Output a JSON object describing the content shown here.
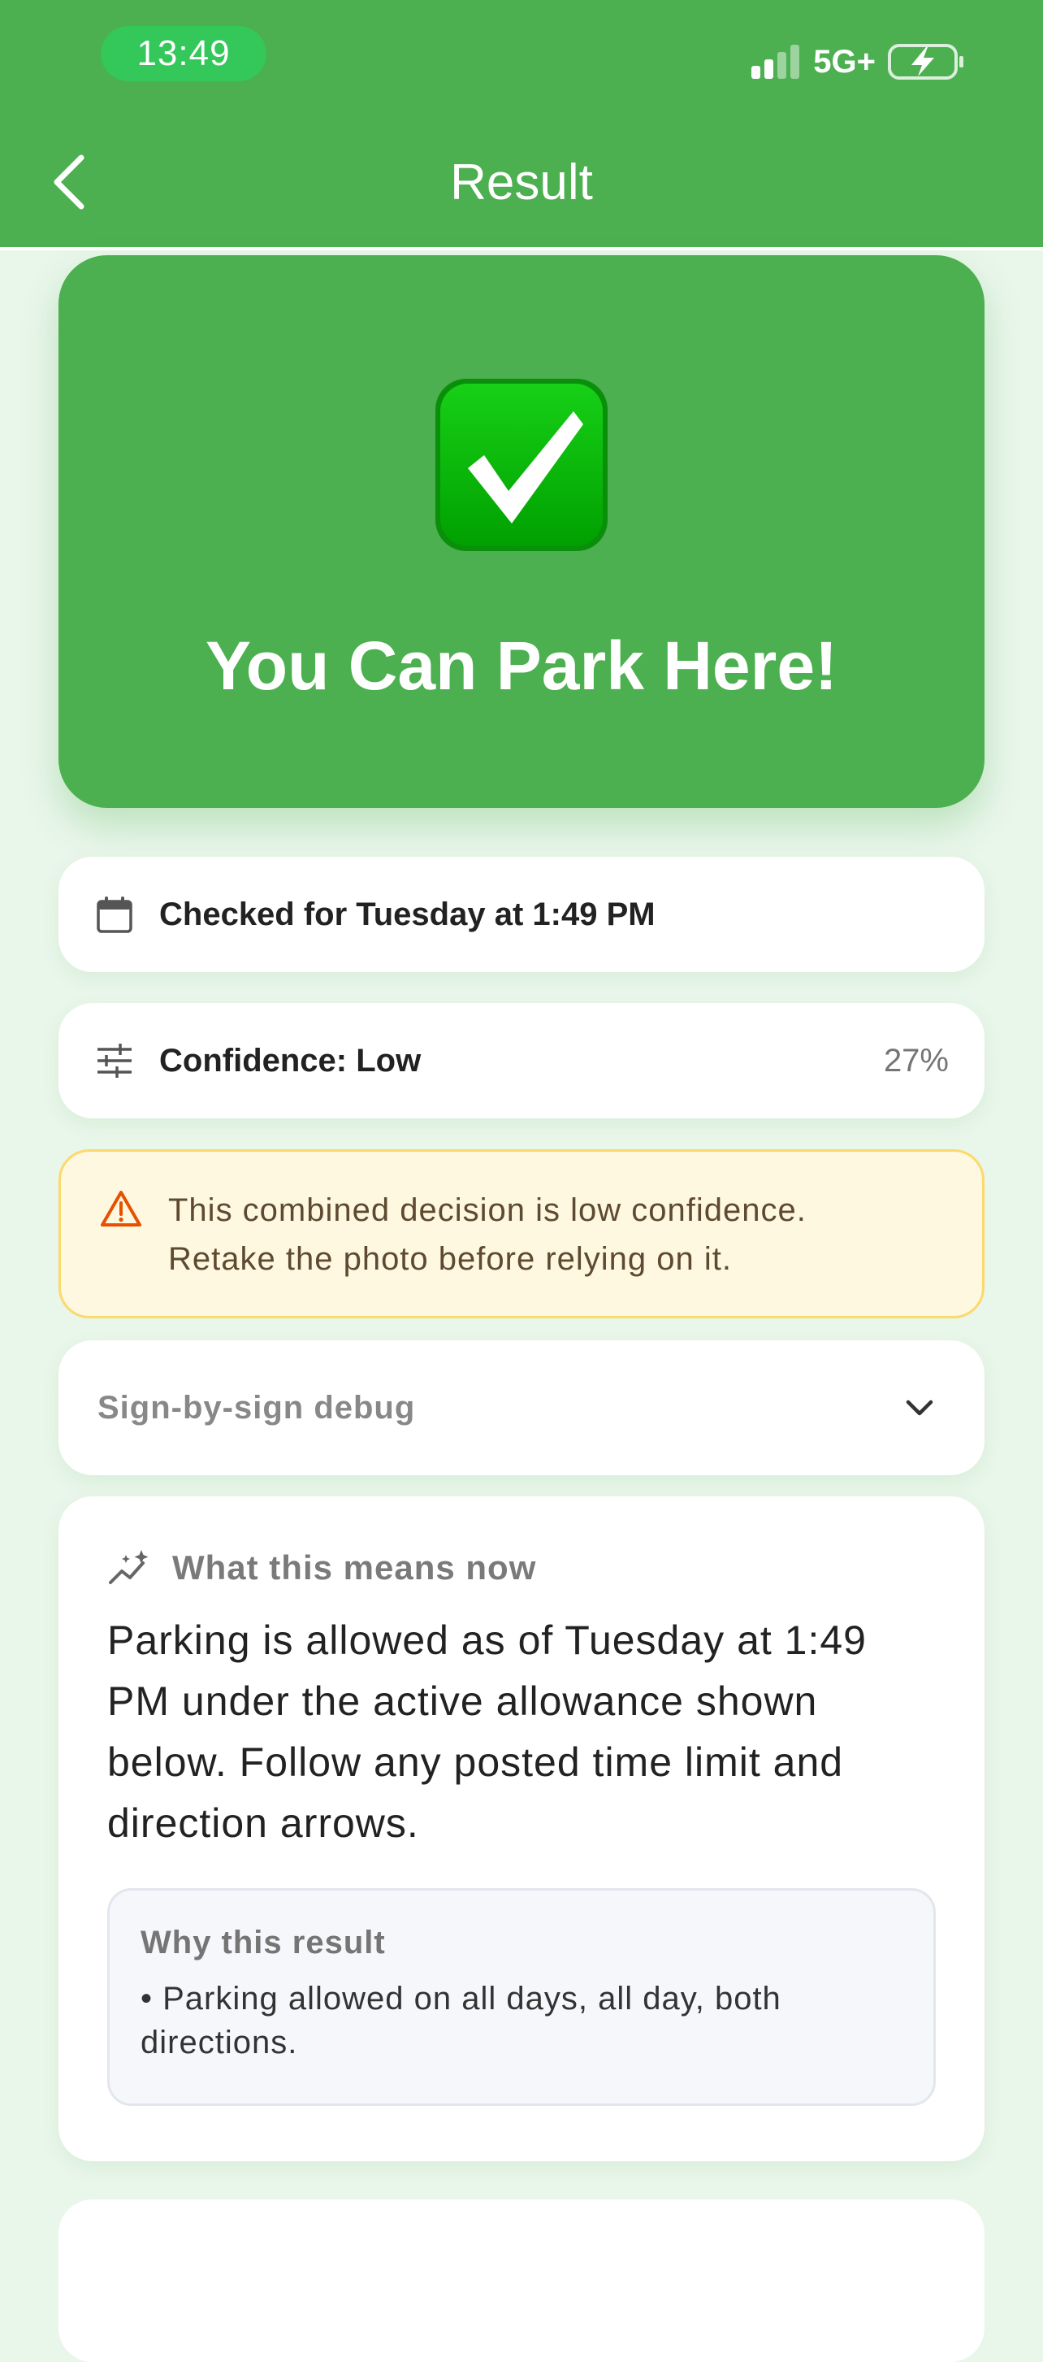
{
  "status_bar": {
    "time": "13:49",
    "network": "5G+"
  },
  "header": {
    "title": "Result"
  },
  "hero": {
    "title": "You Can Park Here!",
    "icon": "check-mark-emoji"
  },
  "checked_row": {
    "label": "Checked for Tuesday at 1:49 PM",
    "icon": "calendar-icon"
  },
  "confidence_row": {
    "label": "Confidence: Low",
    "value": "27%",
    "icon": "sliders-icon"
  },
  "warning": {
    "text_line1": "This combined decision is low confidence.",
    "text_line2": "Retake the photo before relying on it.",
    "icon": "warning-triangle-icon"
  },
  "debug": {
    "label": "Sign-by-sign debug"
  },
  "means": {
    "title": "What this means now",
    "body": "Parking is allowed as of Tuesday at 1:49 PM under the active allowance shown below. Follow any posted time limit and direction arrows.",
    "why_title": "Why this result",
    "why_items": [
      "• Parking allowed on all days, all day, both directions."
    ]
  },
  "colors": {
    "brand_green": "#4caf50",
    "warning_bg": "#fff8e1",
    "warning_border": "#fbd96b",
    "warning_icon": "#e65100",
    "page_bg": "#e9f6ea"
  }
}
